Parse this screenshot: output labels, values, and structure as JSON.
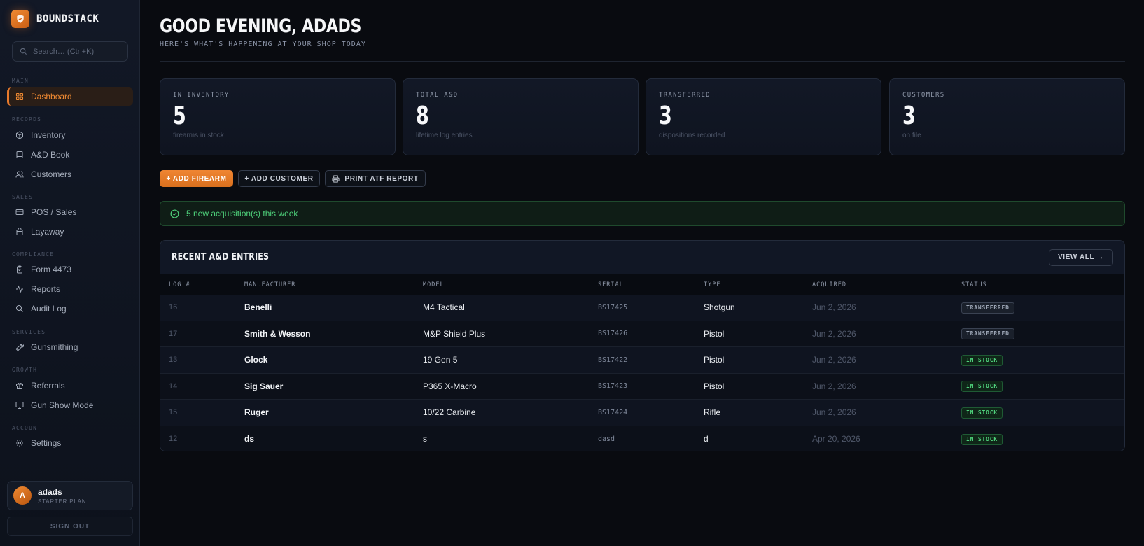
{
  "brand": {
    "name": "BOUNDSTACK"
  },
  "search": {
    "placeholder": "Search… (Ctrl+K)"
  },
  "nav": {
    "sections": {
      "main": "MAIN",
      "records": "RECORDS",
      "sales": "SALES",
      "compliance": "COMPLIANCE",
      "services": "SERVICES",
      "growth": "GROWTH",
      "account": "ACCOUNT"
    },
    "items": {
      "dashboard": "Dashboard",
      "inventory": "Inventory",
      "ad_book": "A&D Book",
      "customers": "Customers",
      "pos": "POS / Sales",
      "layaway": "Layaway",
      "form4473": "Form 4473",
      "reports": "Reports",
      "audit_log": "Audit Log",
      "gunsmithing": "Gunsmithing",
      "referrals": "Referrals",
      "gun_show": "Gun Show Mode",
      "settings": "Settings"
    }
  },
  "user": {
    "initial": "A",
    "name": "adads",
    "plan": "STARTER PLAN",
    "sign_out": "SIGN OUT"
  },
  "header": {
    "greeting": "GOOD EVENING, ADADS",
    "subtitle": "HERE'S WHAT'S HAPPENING AT YOUR SHOP TODAY"
  },
  "stats": [
    {
      "label": "IN INVENTORY",
      "value": "5",
      "sub": "firearms in stock"
    },
    {
      "label": "TOTAL A&D",
      "value": "8",
      "sub": "lifetime log entries"
    },
    {
      "label": "TRANSFERRED",
      "value": "3",
      "sub": "dispositions recorded"
    },
    {
      "label": "CUSTOMERS",
      "value": "3",
      "sub": "on file"
    }
  ],
  "actions": {
    "add_firearm": "+ ADD FIREARM",
    "add_customer": "+ ADD CUSTOMER",
    "print_report": "PRINT ATF REPORT"
  },
  "notice": {
    "text": "5 new acquisition(s) this week"
  },
  "table": {
    "title": "RECENT A&D ENTRIES",
    "view_all": "VIEW ALL →",
    "columns": [
      "LOG #",
      "MANUFACTURER",
      "MODEL",
      "SERIAL",
      "TYPE",
      "ACQUIRED",
      "STATUS"
    ],
    "rows": [
      {
        "log": "16",
        "manufacturer": "Benelli",
        "model": "M4 Tactical",
        "serial": "BS17425",
        "type": "Shotgun",
        "acquired": "Jun 2, 2026",
        "status": "TRANSFERRED"
      },
      {
        "log": "17",
        "manufacturer": "Smith & Wesson",
        "model": "M&P Shield Plus",
        "serial": "BS17426",
        "type": "Pistol",
        "acquired": "Jun 2, 2026",
        "status": "TRANSFERRED"
      },
      {
        "log": "13",
        "manufacturer": "Glock",
        "model": "19 Gen 5",
        "serial": "BS17422",
        "type": "Pistol",
        "acquired": "Jun 2, 2026",
        "status": "IN STOCK"
      },
      {
        "log": "14",
        "manufacturer": "Sig Sauer",
        "model": "P365 X-Macro",
        "serial": "BS17423",
        "type": "Pistol",
        "acquired": "Jun 2, 2026",
        "status": "IN STOCK"
      },
      {
        "log": "15",
        "manufacturer": "Ruger",
        "model": "10/22 Carbine",
        "serial": "BS17424",
        "type": "Rifle",
        "acquired": "Jun 2, 2026",
        "status": "IN STOCK"
      },
      {
        "log": "12",
        "manufacturer": "ds",
        "model": "s",
        "serial": "dasd",
        "type": "d",
        "acquired": "Apr 20, 2026",
        "status": "IN STOCK"
      }
    ]
  },
  "colors": {
    "accent": "#e87a2c",
    "success": "#4ed07a",
    "background": "#090b10"
  }
}
